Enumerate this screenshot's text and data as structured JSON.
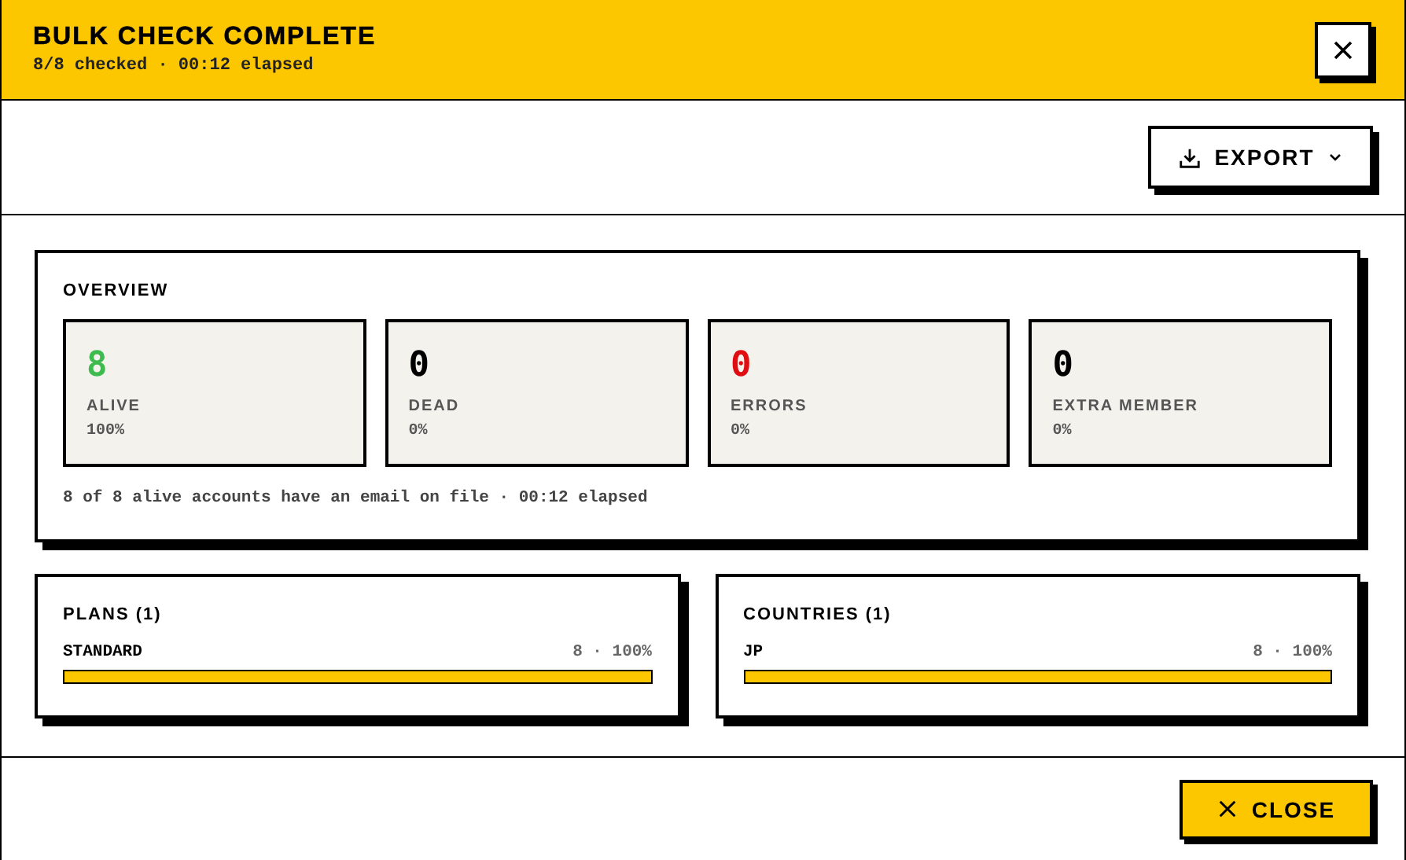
{
  "header": {
    "title": "BULK CHECK COMPLETE",
    "subtitle": "8/8 checked · 00:12 elapsed"
  },
  "toolbar": {
    "export_label": "EXPORT"
  },
  "overview": {
    "title": "OVERVIEW",
    "stats": [
      {
        "value": "8",
        "label": "ALIVE",
        "percent": "100%",
        "color": "#3dbb4e"
      },
      {
        "value": "0",
        "label": "DEAD",
        "percent": "0%",
        "color": "#000000"
      },
      {
        "value": "0",
        "label": "ERRORS",
        "percent": "0%",
        "color": "#e00d12"
      },
      {
        "value": "0",
        "label": "EXTRA MEMBER",
        "percent": "0%",
        "color": "#000000"
      }
    ],
    "note": "8 of 8 alive accounts have an email on file · 00:12 elapsed"
  },
  "breakdowns": [
    {
      "title": "PLANS (1)",
      "rows": [
        {
          "name": "STANDARD",
          "reading": "8 · 100%",
          "level": 1
        }
      ]
    },
    {
      "title": "COUNTRIES (1)",
      "rows": [
        {
          "name": "JP",
          "reading": "8 · 100%",
          "level": 1
        }
      ]
    }
  ],
  "footer": {
    "close_label": "CLOSE"
  }
}
